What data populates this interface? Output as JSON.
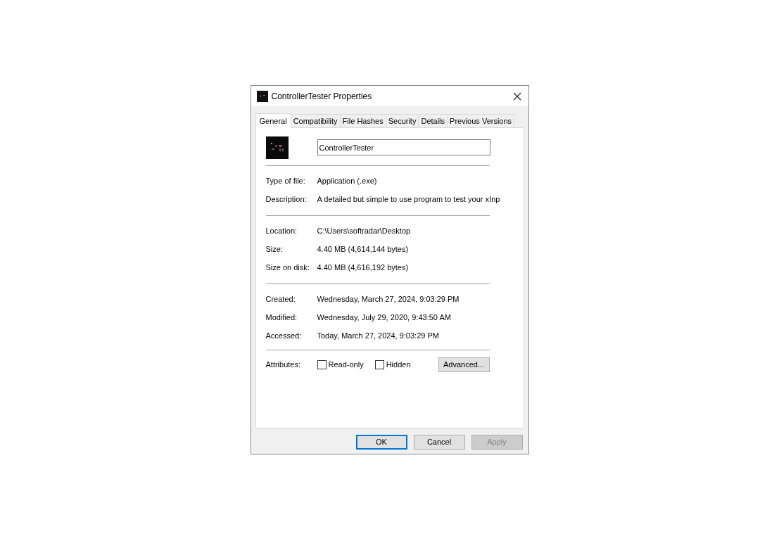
{
  "window": {
    "title": "ControllerTester Properties"
  },
  "tabs": [
    {
      "label": "General",
      "selected": true
    },
    {
      "label": "Compatibility",
      "selected": false
    },
    {
      "label": "File Hashes",
      "selected": false
    },
    {
      "label": "Security",
      "selected": false
    },
    {
      "label": "Details",
      "selected": false
    },
    {
      "label": "Previous Versions",
      "selected": false
    }
  ],
  "file_name": {
    "value": "ControllerTester"
  },
  "sections": [
    {
      "rows": [
        {
          "label": "Type of file:",
          "value": "Application (.exe)"
        },
        {
          "label": "Description:",
          "value": "A detailed but simple to use program to test your xInp"
        }
      ]
    },
    {
      "rows": [
        {
          "label": "Location:",
          "value": "C:\\Users\\softradar\\Desktop"
        },
        {
          "label": "Size:",
          "value": "4.40 MB (4,614,144 bytes)"
        },
        {
          "label": "Size on disk:",
          "value": "4.40 MB (4,616,192 bytes)"
        }
      ]
    },
    {
      "rows": [
        {
          "label": "Created:",
          "value": "Wednesday, March 27, 2024, 9:03:29 PM"
        },
        {
          "label": "Modified:",
          "value": "Wednesday, July 29, 2020, 9:43:50 AM"
        },
        {
          "label": "Accessed:",
          "value": "Today, March 27, 2024, 9:03:29 PM"
        }
      ]
    }
  ],
  "attributes": {
    "label": "Attributes:",
    "checkboxes": [
      {
        "label": "Read-only",
        "checked": false
      },
      {
        "label": "Hidden",
        "checked": false
      }
    ],
    "advanced_button": "Advanced..."
  },
  "buttons": [
    {
      "label": "OK",
      "default": true,
      "disabled": false
    },
    {
      "label": "Cancel",
      "default": false,
      "disabled": false
    },
    {
      "label": "Apply",
      "default": false,
      "disabled": true
    }
  ]
}
